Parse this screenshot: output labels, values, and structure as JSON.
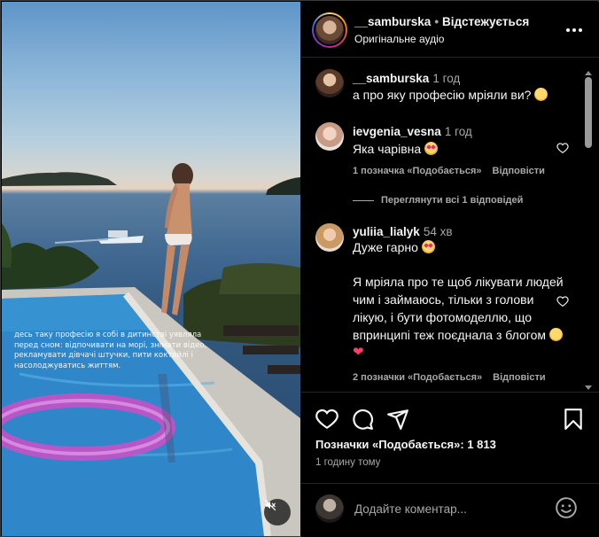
{
  "video": {
    "overlay_text": "десь таку професію я собі в дитинстві уявляла перед сном: відпочивати на морі, знімати відео, рекламувати дівчачі штучки, пити коктейлі і насолоджуватись життям."
  },
  "header": {
    "username": "__samburska",
    "separator": "•",
    "follow_label": "Відстежується",
    "audio_label": "Оригінальне аудіо"
  },
  "comments": [
    {
      "username": "__samburska",
      "time": "1 год",
      "text": "а про яку професію мріяли ви?"
    },
    {
      "username": "ievgenia_vesna",
      "time": "1 год",
      "text": "Яка чарівна",
      "likes_label": "1 позначка «Подобається»",
      "reply_label": "Відповісти",
      "view_replies_label": "Переглянути всі 1 відповідей"
    },
    {
      "username": "yuliia_lialyk",
      "time": "54 хв",
      "text_line1": "Дуже гарно",
      "text_body": "Я мріяла про те щоб лікувати людей чим і займаюсь, тільки з голови лікую, і бути фотомоделлю, що впринципі теж поєднала з блогом",
      "likes_label": "2 позначки «Подобається»",
      "reply_label": "Відповісти"
    }
  ],
  "actions": {
    "likes_text": "Позначки «Подобається»: 1 813",
    "posted_time": "1 годину тому"
  },
  "add_comment": {
    "placeholder": "Додайте коментар..."
  },
  "icons": [
    "more-icon",
    "heart-icon",
    "comment-icon",
    "share-icon",
    "bookmark-icon",
    "mute-icon",
    "emoji-icon"
  ],
  "colors": {
    "background": "#000000",
    "text": "#f5f5f5",
    "muted": "#a8a8a8",
    "divider": "#262626"
  }
}
